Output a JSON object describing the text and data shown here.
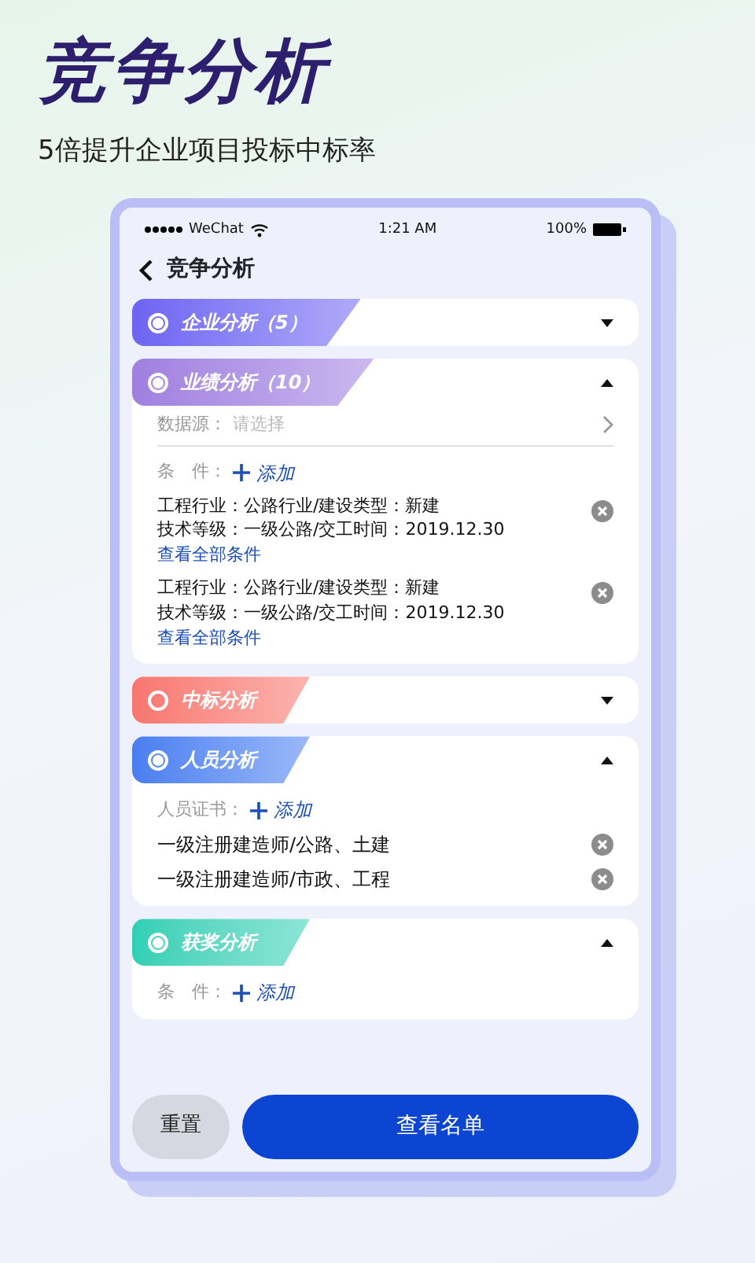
{
  "headline": "竞争分析",
  "subtitle": "5倍提升企业项目投标中标率",
  "status_bar": {
    "carrier": "WeChat",
    "time": "1:21 AM",
    "battery": "100%"
  },
  "nav": {
    "title": "竞争分析"
  },
  "sections": [
    {
      "title": "企业分析（5）",
      "color": "#6f63f2",
      "selected": true,
      "expanded": false
    },
    {
      "title": "业绩分析（10）",
      "color": "#a07fe0",
      "selected": true,
      "expanded": true,
      "rows": [
        {
          "kind": "select",
          "label": "数据源：",
          "placeholder": "请选择"
        },
        {
          "kind": "add",
          "label": "条　件：",
          "action": "添加"
        },
        {
          "kind": "condition",
          "lines": [
            "工程行业：公路行业/建设类型：新建",
            "技术等级：一级公路/交工时间：2019.12.30"
          ],
          "link": "查看全部条件"
        },
        {
          "kind": "condition",
          "lines": [
            "工程行业：公路行业/建设类型：新建",
            "技术等级：一级公路/交工时间：2019.12.30"
          ],
          "link": "查看全部条件"
        }
      ]
    },
    {
      "title": "中标分析",
      "color": "#f7766f",
      "selected": false,
      "expanded": false
    },
    {
      "title": "人员分析",
      "color": "#4a7ef0",
      "selected": true,
      "expanded": true,
      "rows": [
        {
          "kind": "add",
          "label": "人员证书：",
          "action": "添加"
        },
        {
          "kind": "item",
          "text": "一级注册建造师/公路、土建"
        },
        {
          "kind": "item",
          "text": "一级注册建造师/市政、工程"
        }
      ]
    },
    {
      "title": "获奖分析",
      "color": "#2fcfb5",
      "selected": true,
      "expanded": true,
      "rows": [
        {
          "kind": "add",
          "label": "条　件：",
          "action": "添加"
        }
      ]
    }
  ],
  "buttons": [
    {
      "label": "重置",
      "kind": "secondary"
    },
    {
      "label": "查看名单",
      "kind": "primary"
    }
  ]
}
